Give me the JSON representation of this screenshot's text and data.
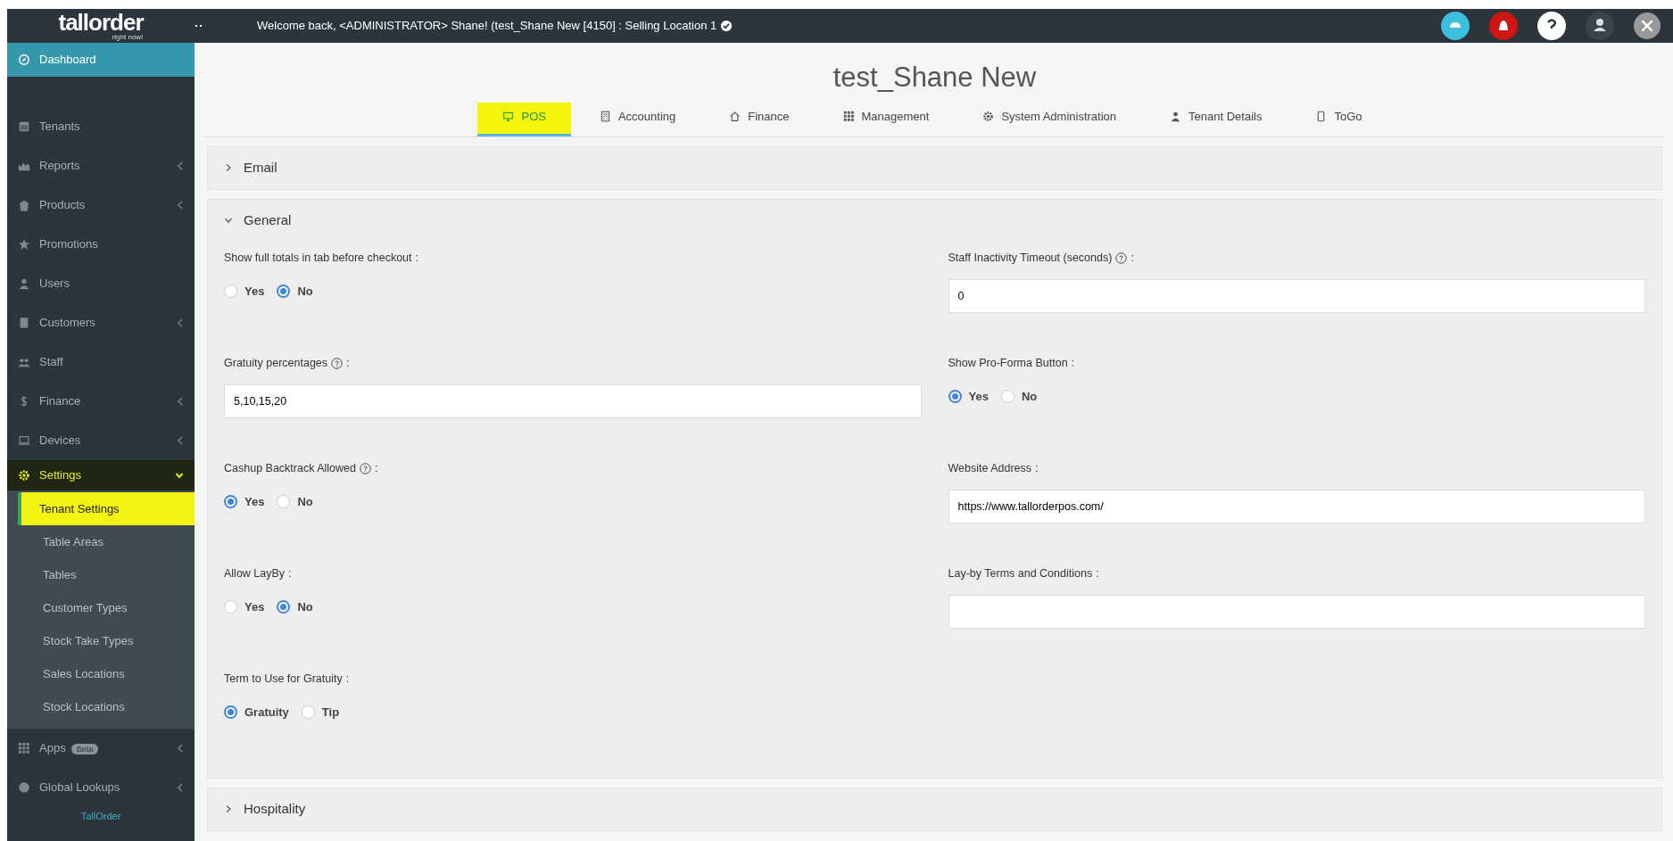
{
  "header": {
    "logo": "tallorder",
    "logo_tagline": "right now!",
    "welcome": "Welcome back, <ADMINISTRATOR> Shane! (test_Shane New [4150] : Selling Location 1"
  },
  "sidebar": {
    "items": [
      {
        "label": "Dashboard",
        "active": true,
        "submenu": false
      },
      {
        "label": "Tenants",
        "active": false,
        "submenu": false
      },
      {
        "label": "Reports",
        "active": false,
        "submenu": true
      },
      {
        "label": "Products",
        "active": false,
        "submenu": true
      },
      {
        "label": "Promotions",
        "active": false,
        "submenu": false
      },
      {
        "label": "Users",
        "active": false,
        "submenu": false
      },
      {
        "label": "Customers",
        "active": false,
        "submenu": true
      },
      {
        "label": "Staff",
        "active": false,
        "submenu": false
      },
      {
        "label": "Finance",
        "active": false,
        "submenu": true
      },
      {
        "label": "Devices",
        "active": false,
        "submenu": true
      },
      {
        "label": "Settings",
        "active": false,
        "submenu": true,
        "expanded": true,
        "highlighted": true,
        "children": [
          {
            "label": "Tenant Settings",
            "selected": true,
            "highlighted": true
          },
          {
            "label": "Table Areas",
            "selected": false
          },
          {
            "label": "Tables",
            "selected": false
          },
          {
            "label": "Customer Types",
            "selected": false
          },
          {
            "label": "Stock Take Types",
            "selected": false
          },
          {
            "label": "Sales Locations",
            "selected": false
          },
          {
            "label": "Stock Locations",
            "selected": false
          }
        ]
      },
      {
        "label": "Apps",
        "active": false,
        "submenu": true,
        "badge": "Beta"
      },
      {
        "label": "Global Lookups",
        "active": false,
        "submenu": true
      }
    ],
    "footer": "TallOrder"
  },
  "page": {
    "title": "test_Shane New",
    "tabs": [
      {
        "label": "POS",
        "selected": true,
        "highlighted": true
      },
      {
        "label": "Accounting",
        "selected": false
      },
      {
        "label": "Finance",
        "selected": false
      },
      {
        "label": "Management",
        "selected": false
      },
      {
        "label": "System Administration",
        "selected": false
      },
      {
        "label": "Tenant Details",
        "selected": false
      },
      {
        "label": "ToGo",
        "selected": false
      }
    ],
    "panels": [
      {
        "title": "Email",
        "expanded": false
      },
      {
        "title": "General",
        "expanded": true,
        "columns": [
          [
            {
              "kind": "radio",
              "label": "Show full totals in tab before checkout",
              "help": false,
              "punct": ":",
              "options": [
                {
                  "label": "Yes",
                  "selected": false
                },
                {
                  "label": "No",
                  "selected": true
                }
              ]
            },
            {
              "kind": "text",
              "label": "Gratuity percentages",
              "help": true,
              "punct": ":",
              "value": "5,10,15,20"
            },
            {
              "kind": "radio",
              "label": "Cashup Backtrack Allowed",
              "help": true,
              "punct": ":",
              "options": [
                {
                  "label": "Yes",
                  "selected": true
                },
                {
                  "label": "No",
                  "selected": false
                }
              ]
            },
            {
              "kind": "radio",
              "label": "Allow LayBy",
              "help": false,
              "punct": ":",
              "options": [
                {
                  "label": "Yes",
                  "selected": false
                },
                {
                  "label": "No",
                  "selected": true
                }
              ]
            },
            {
              "kind": "radio",
              "label": "Term to Use for Gratuity",
              "help": false,
              "punct": ":",
              "options": [
                {
                  "label": "Gratuity",
                  "selected": true
                },
                {
                  "label": "Tip",
                  "selected": false
                }
              ]
            }
          ],
          [
            {
              "kind": "text",
              "label": "Staff Inactivity Timeout (seconds)",
              "help": true,
              "punct": ":",
              "value": "0"
            },
            {
              "kind": "radio",
              "label": "Show Pro-Forma Button",
              "help": false,
              "punct": ":",
              "options": [
                {
                  "label": "Yes",
                  "selected": true
                },
                {
                  "label": "No",
                  "selected": false
                }
              ]
            },
            {
              "kind": "text",
              "label": "Website Address",
              "help": false,
              "punct": ":",
              "value": "https://www.tallorderpos.com/"
            },
            {
              "kind": "text",
              "label": "Lay-by Terms and Conditions",
              "help": false,
              "punct": ":"
            }
          ]
        ]
      },
      {
        "title": "Hospitality",
        "expanded": false
      }
    ]
  }
}
